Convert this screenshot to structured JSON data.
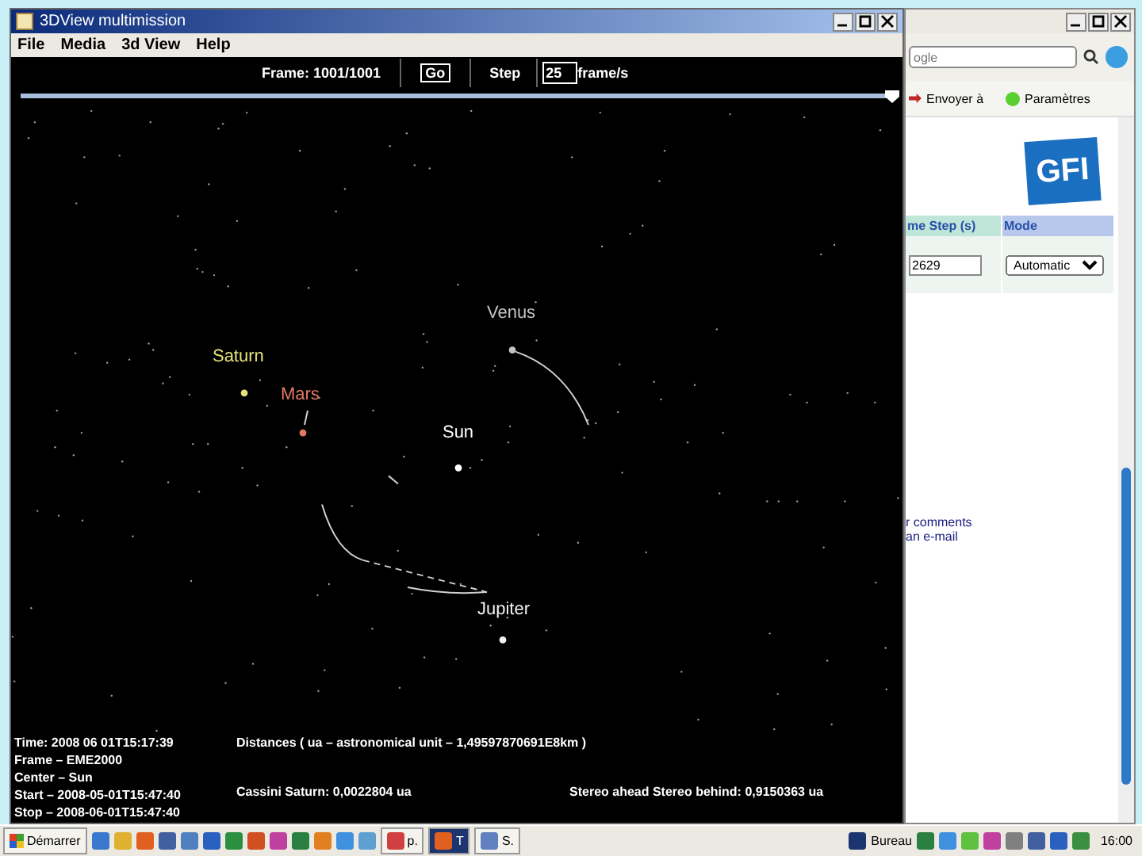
{
  "app_window": {
    "title": "3DView multimission",
    "menu": [
      "File",
      "Media",
      "3d View",
      "Help"
    ],
    "toolbar": {
      "frame": "Frame: 1001/1001",
      "go": "Go",
      "step_label": "Step",
      "step_value": "25",
      "unit": "frame/s"
    },
    "timeline": {
      "level": 1
    },
    "planets": [
      {
        "name": "Saturn",
        "color": "#e6e27a"
      },
      {
        "name": "Mars",
        "color": "#e07a62"
      },
      {
        "name": "Sun",
        "color": "#ffffff"
      },
      {
        "name": "Venus",
        "color": "#c4c4c4"
      },
      {
        "name": "Jupiter",
        "color": "#f2f2f2"
      }
    ],
    "info": {
      "time": "Time: 2008 06 01T15:17:39",
      "distances": "Distances ( ua – astronomical unit – 1,49597870691E8km )",
      "frame_lines": [
        "Frame – EME2000",
        "Center – Sun",
        "Start – 2008-05-01T15:47:40",
        "Stop – 2008-06-01T15:47:40"
      ],
      "cassini": "Cassini Saturn: 0,0022804 ua",
      "stereo": "Stereo ahead Stereo behind: 0,9150363 ua"
    }
  },
  "browser": {
    "search_placeholder": "ogle",
    "toolbar": [
      "Envoyer à",
      "Paramètres"
    ],
    "logo": "GFI",
    "columns": [
      "me Step (s)",
      "Mode"
    ],
    "step_value": "2629",
    "mode": "Automatic",
    "links": [
      "r comments",
      "an e-mail"
    ]
  },
  "taskbar": {
    "start": "Démarrer",
    "tasks": [
      {
        "label": "p.",
        "selected": false
      },
      {
        "label": "T",
        "selected": true
      },
      {
        "label": "S.",
        "selected": false
      }
    ],
    "desk": "Bureau",
    "clock": "16:00"
  }
}
